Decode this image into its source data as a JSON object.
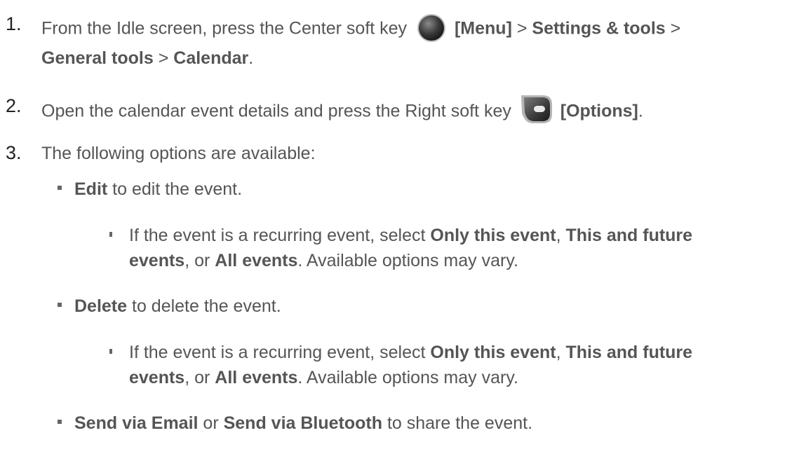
{
  "steps": [
    {
      "number": "1.",
      "line1": {
        "pre": "From the Idle screen, press the Center soft key",
        "b1": "[Menu]",
        "sep1": " > ",
        "b2": "Settings & tools",
        "sep2": " >"
      },
      "line2": {
        "b1": "General tools",
        "sep1": " > ",
        "b2": "Calendar",
        "post": "."
      },
      "icon": "center-soft-key-icon"
    },
    {
      "number": "2.",
      "pre": "Open the calendar event details and press the Right soft key",
      "b1": "[Options]",
      "post": ".",
      "icon": "right-soft-key-icon"
    },
    {
      "number": "3.",
      "text": "The following options are available:"
    }
  ],
  "options": [
    {
      "b1": "Edit",
      "post": " to edit the event.",
      "sub": {
        "line1": {
          "pre": "If the event is a recurring event, select ",
          "b1": "Only this event",
          "mid": ", ",
          "b2": "This and future"
        },
        "line2": {
          "b1": "events",
          "mid": ", or ",
          "b2": "All events",
          "post": ". Available options may vary."
        }
      }
    },
    {
      "b1": "Delete",
      "post": " to delete the event.",
      "sub": {
        "line1": {
          "pre": "If the event is a recurring event, select ",
          "b1": "Only this event",
          "mid": ", ",
          "b2": "This and future"
        },
        "line2": {
          "b1": "events",
          "mid": ", or ",
          "b2": "All events",
          "post": ". Available options may vary."
        }
      }
    },
    {
      "b1": "Send via Email",
      "mid": " or ",
      "b2": "Send via Bluetooth",
      "post": " to share the event."
    }
  ]
}
